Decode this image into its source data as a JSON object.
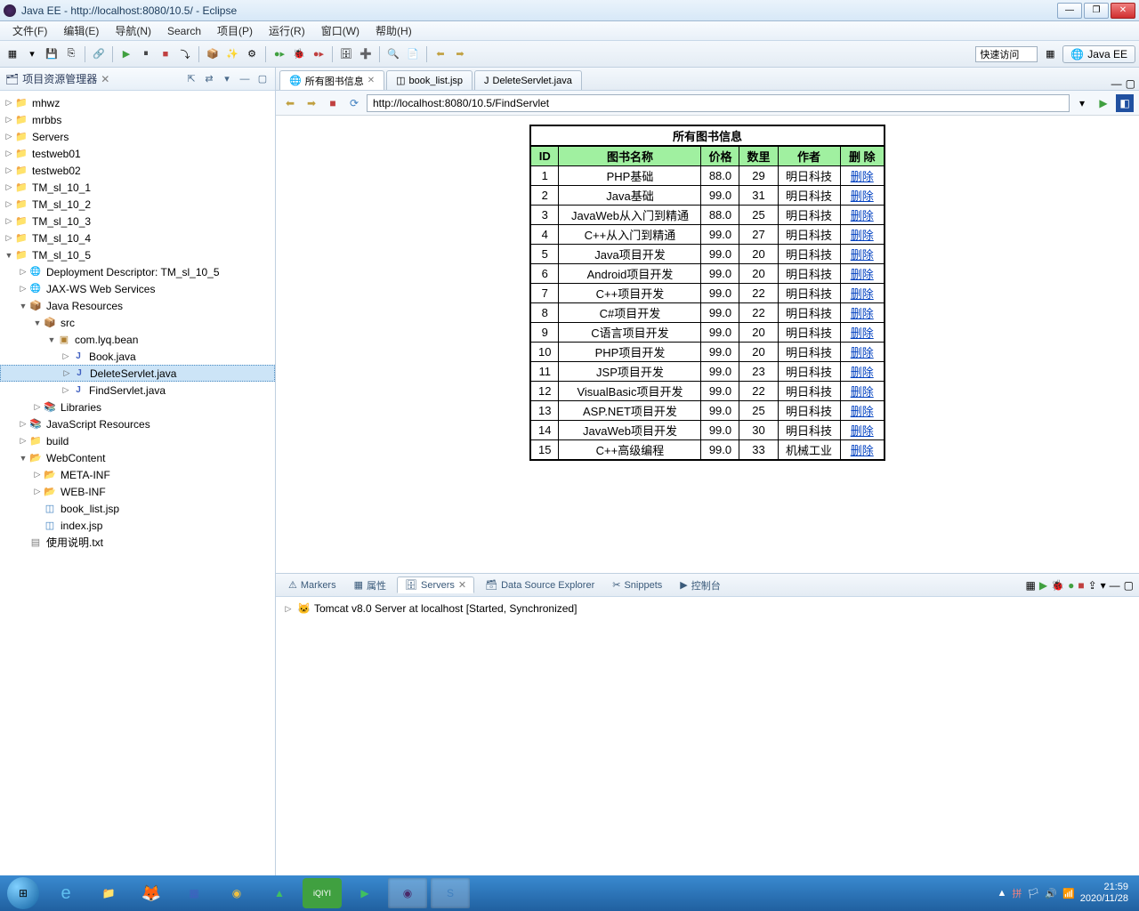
{
  "titlebar": {
    "title": "Java EE - http://localhost:8080/10.5/ - Eclipse"
  },
  "menu": [
    "文件(F)",
    "编辑(E)",
    "导航(N)",
    "Search",
    "项目(P)",
    "运行(R)",
    "窗口(W)",
    "帮助(H)"
  ],
  "toolbar_right": {
    "quick_access": "快速访问",
    "perspective": "Java EE"
  },
  "project_explorer": {
    "title": "项目资源管理器"
  },
  "tree": {
    "roots": [
      "mhwz",
      "mrbbs",
      "Servers",
      "testweb01",
      "testweb02",
      "TM_sl_10_1",
      "TM_sl_10_2",
      "TM_sl_10_3",
      "TM_sl_10_4"
    ],
    "open_proj": "TM_sl_10_5",
    "dd": "Deployment Descriptor: TM_sl_10_5",
    "jax": "JAX-WS Web Services",
    "jr": "Java Resources",
    "src": "src",
    "pkg": "com.lyq.bean",
    "files": [
      "Book.java",
      "DeleteServlet.java",
      "FindServlet.java"
    ],
    "libs": "Libraries",
    "jsr": "JavaScript Resources",
    "build": "build",
    "webcontent": "WebContent",
    "meta": "META-INF",
    "webinf": "WEB-INF",
    "jsp1": "book_list.jsp",
    "jsp2": "index.jsp",
    "readme": "使用说明.txt"
  },
  "tabs": [
    {
      "label": "所有图书信息",
      "active": true,
      "icon": "web"
    },
    {
      "label": "book_list.jsp",
      "active": false,
      "icon": "jsp"
    },
    {
      "label": "DeleteServlet.java",
      "active": false,
      "icon": "java"
    }
  ],
  "url": "http://localhost:8080/10.5/FindServlet",
  "page": {
    "heading": "所有图书信息",
    "columns": [
      "ID",
      "图书名称",
      "价格",
      "数里",
      "作者",
      "删  除"
    ],
    "delete_label": "删除",
    "rows": [
      {
        "id": 1,
        "name": "PHP基础",
        "price": "88.0",
        "qty": 29,
        "author": "明日科技"
      },
      {
        "id": 2,
        "name": "Java基础",
        "price": "99.0",
        "qty": 31,
        "author": "明日科技"
      },
      {
        "id": 3,
        "name": "JavaWeb从入门到精通",
        "price": "88.0",
        "qty": 25,
        "author": "明日科技"
      },
      {
        "id": 4,
        "name": "C++从入门到精通",
        "price": "99.0",
        "qty": 27,
        "author": "明日科技"
      },
      {
        "id": 5,
        "name": "Java项目开发",
        "price": "99.0",
        "qty": 20,
        "author": "明日科技"
      },
      {
        "id": 6,
        "name": "Android项目开发",
        "price": "99.0",
        "qty": 20,
        "author": "明日科技"
      },
      {
        "id": 7,
        "name": "C++项目开发",
        "price": "99.0",
        "qty": 22,
        "author": "明日科技"
      },
      {
        "id": 8,
        "name": "C#项目开发",
        "price": "99.0",
        "qty": 22,
        "author": "明日科技"
      },
      {
        "id": 9,
        "name": "C语言项目开发",
        "price": "99.0",
        "qty": 20,
        "author": "明日科技"
      },
      {
        "id": 10,
        "name": "PHP项目开发",
        "price": "99.0",
        "qty": 20,
        "author": "明日科技"
      },
      {
        "id": 11,
        "name": "JSP项目开发",
        "price": "99.0",
        "qty": 23,
        "author": "明日科技"
      },
      {
        "id": 12,
        "name": "VisualBasic项目开发",
        "price": "99.0",
        "qty": 22,
        "author": "明日科技"
      },
      {
        "id": 13,
        "name": "ASP.NET项目开发",
        "price": "99.0",
        "qty": 25,
        "author": "明日科技"
      },
      {
        "id": 14,
        "name": "JavaWeb项目开发",
        "price": "99.0",
        "qty": 30,
        "author": "明日科技"
      },
      {
        "id": 15,
        "name": "C++高级编程",
        "price": "99.0",
        "qty": 33,
        "author": "机械工业"
      }
    ]
  },
  "bottom": {
    "tabs": [
      "Markers",
      "属性",
      "Servers",
      "Data Source Explorer",
      "Snippets",
      "控制台"
    ],
    "active": 2,
    "server": "Tomcat v8.0 Server at localhost  [Started, Synchronized]"
  },
  "taskbar": {
    "time": "21:59",
    "date": "2020/11/28"
  }
}
